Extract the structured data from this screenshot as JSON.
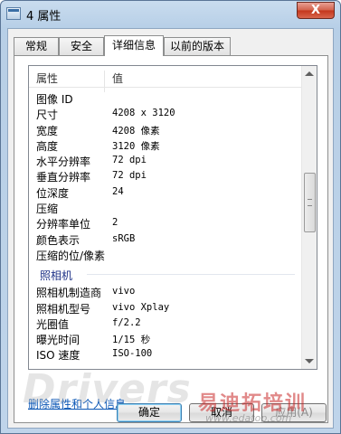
{
  "window": {
    "title": "4 属性",
    "close_glyph": "X"
  },
  "tabs": [
    {
      "label": "常规"
    },
    {
      "label": "安全"
    },
    {
      "label": "详细信息"
    },
    {
      "label": "以前的版本"
    }
  ],
  "details": {
    "header": {
      "property": "属性",
      "value": "值"
    },
    "rows_image": [
      {
        "key": "图像 ID",
        "value": ""
      },
      {
        "key": "尺寸",
        "value": "4208 x 3120"
      },
      {
        "key": "宽度",
        "value": "4208 像素"
      },
      {
        "key": "高度",
        "value": "3120 像素"
      },
      {
        "key": "水平分辨率",
        "value": "72 dpi"
      },
      {
        "key": "垂直分辨率",
        "value": "72 dpi"
      },
      {
        "key": "位深度",
        "value": "24"
      },
      {
        "key": "压缩",
        "value": ""
      },
      {
        "key": "分辨率单位",
        "value": "2"
      },
      {
        "key": "颜色表示",
        "value": "sRGB"
      },
      {
        "key": "压缩的位/像素",
        "value": ""
      }
    ],
    "group_camera": "照相机",
    "rows_camera": [
      {
        "key": "照相机制造商",
        "value": "vivo"
      },
      {
        "key": "照相机型号",
        "value": "vivo Xplay"
      },
      {
        "key": "光圈值",
        "value": "f/2.2"
      },
      {
        "key": "曝光时间",
        "value": "1/15 秒"
      },
      {
        "key": "ISO 速度",
        "value": "ISO-100"
      }
    ]
  },
  "remove_link": "删除属性和个人信息",
  "buttons": {
    "ok": "确定",
    "cancel": "取消",
    "apply": "应用(A)"
  },
  "watermark": {
    "text": "Drivers",
    "text_cn": "易迪拓培训",
    "url": "www.edatop.com"
  }
}
